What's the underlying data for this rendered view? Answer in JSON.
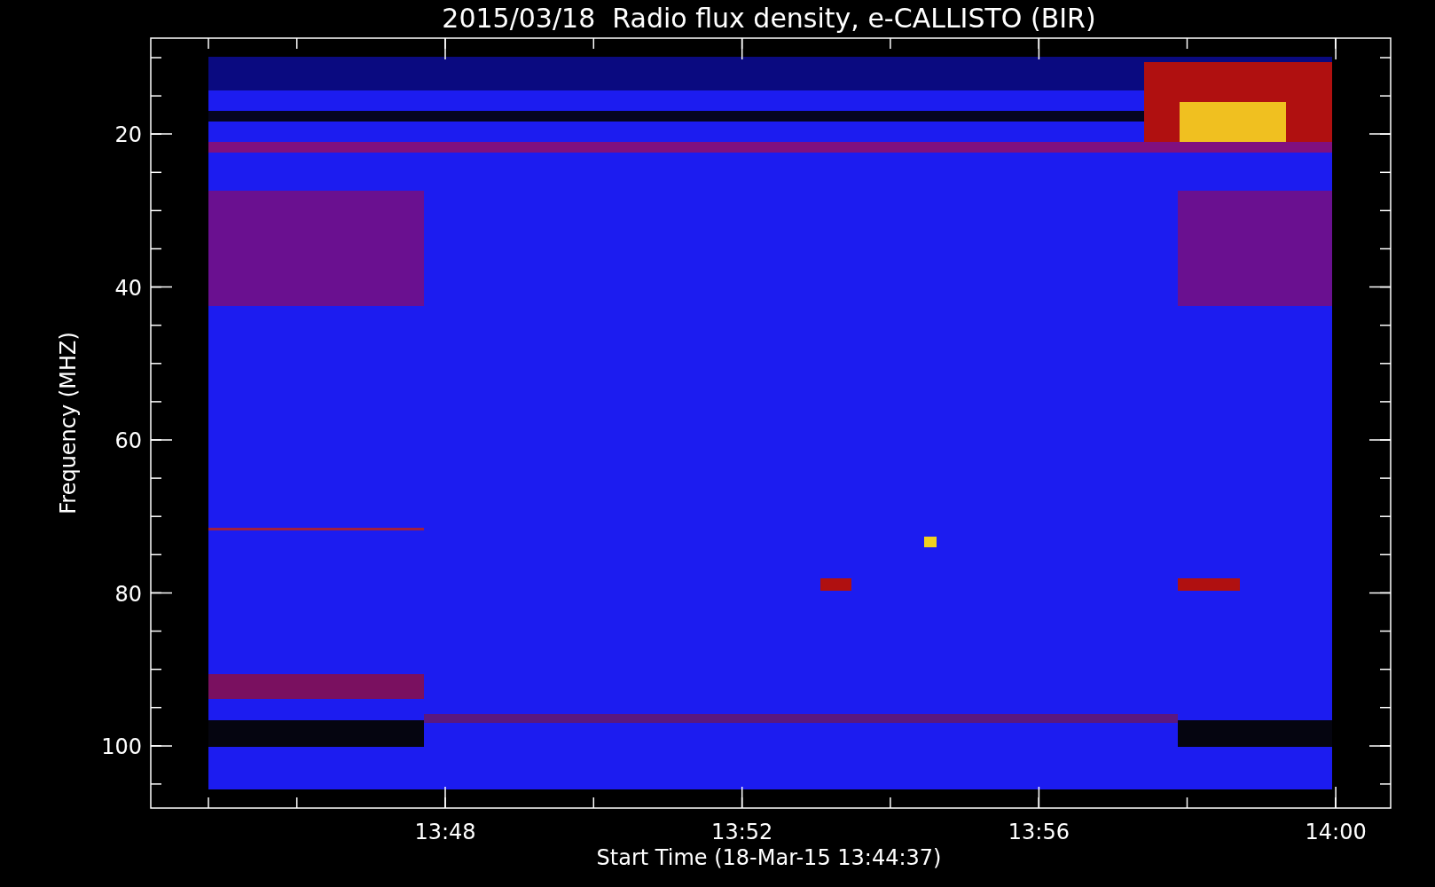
{
  "title": "2015/03/18  Radio flux density, e-CALLISTO (BIR)",
  "y_axis": {
    "label": "Frequency (MHZ)",
    "ticks": [
      "20",
      "40",
      "60",
      "80",
      "100"
    ]
  },
  "x_axis": {
    "label": "Start Time (18-Mar-15 13:44:37)",
    "ticks": [
      "13:48",
      "13:52",
      "13:56",
      "14:00"
    ]
  }
}
